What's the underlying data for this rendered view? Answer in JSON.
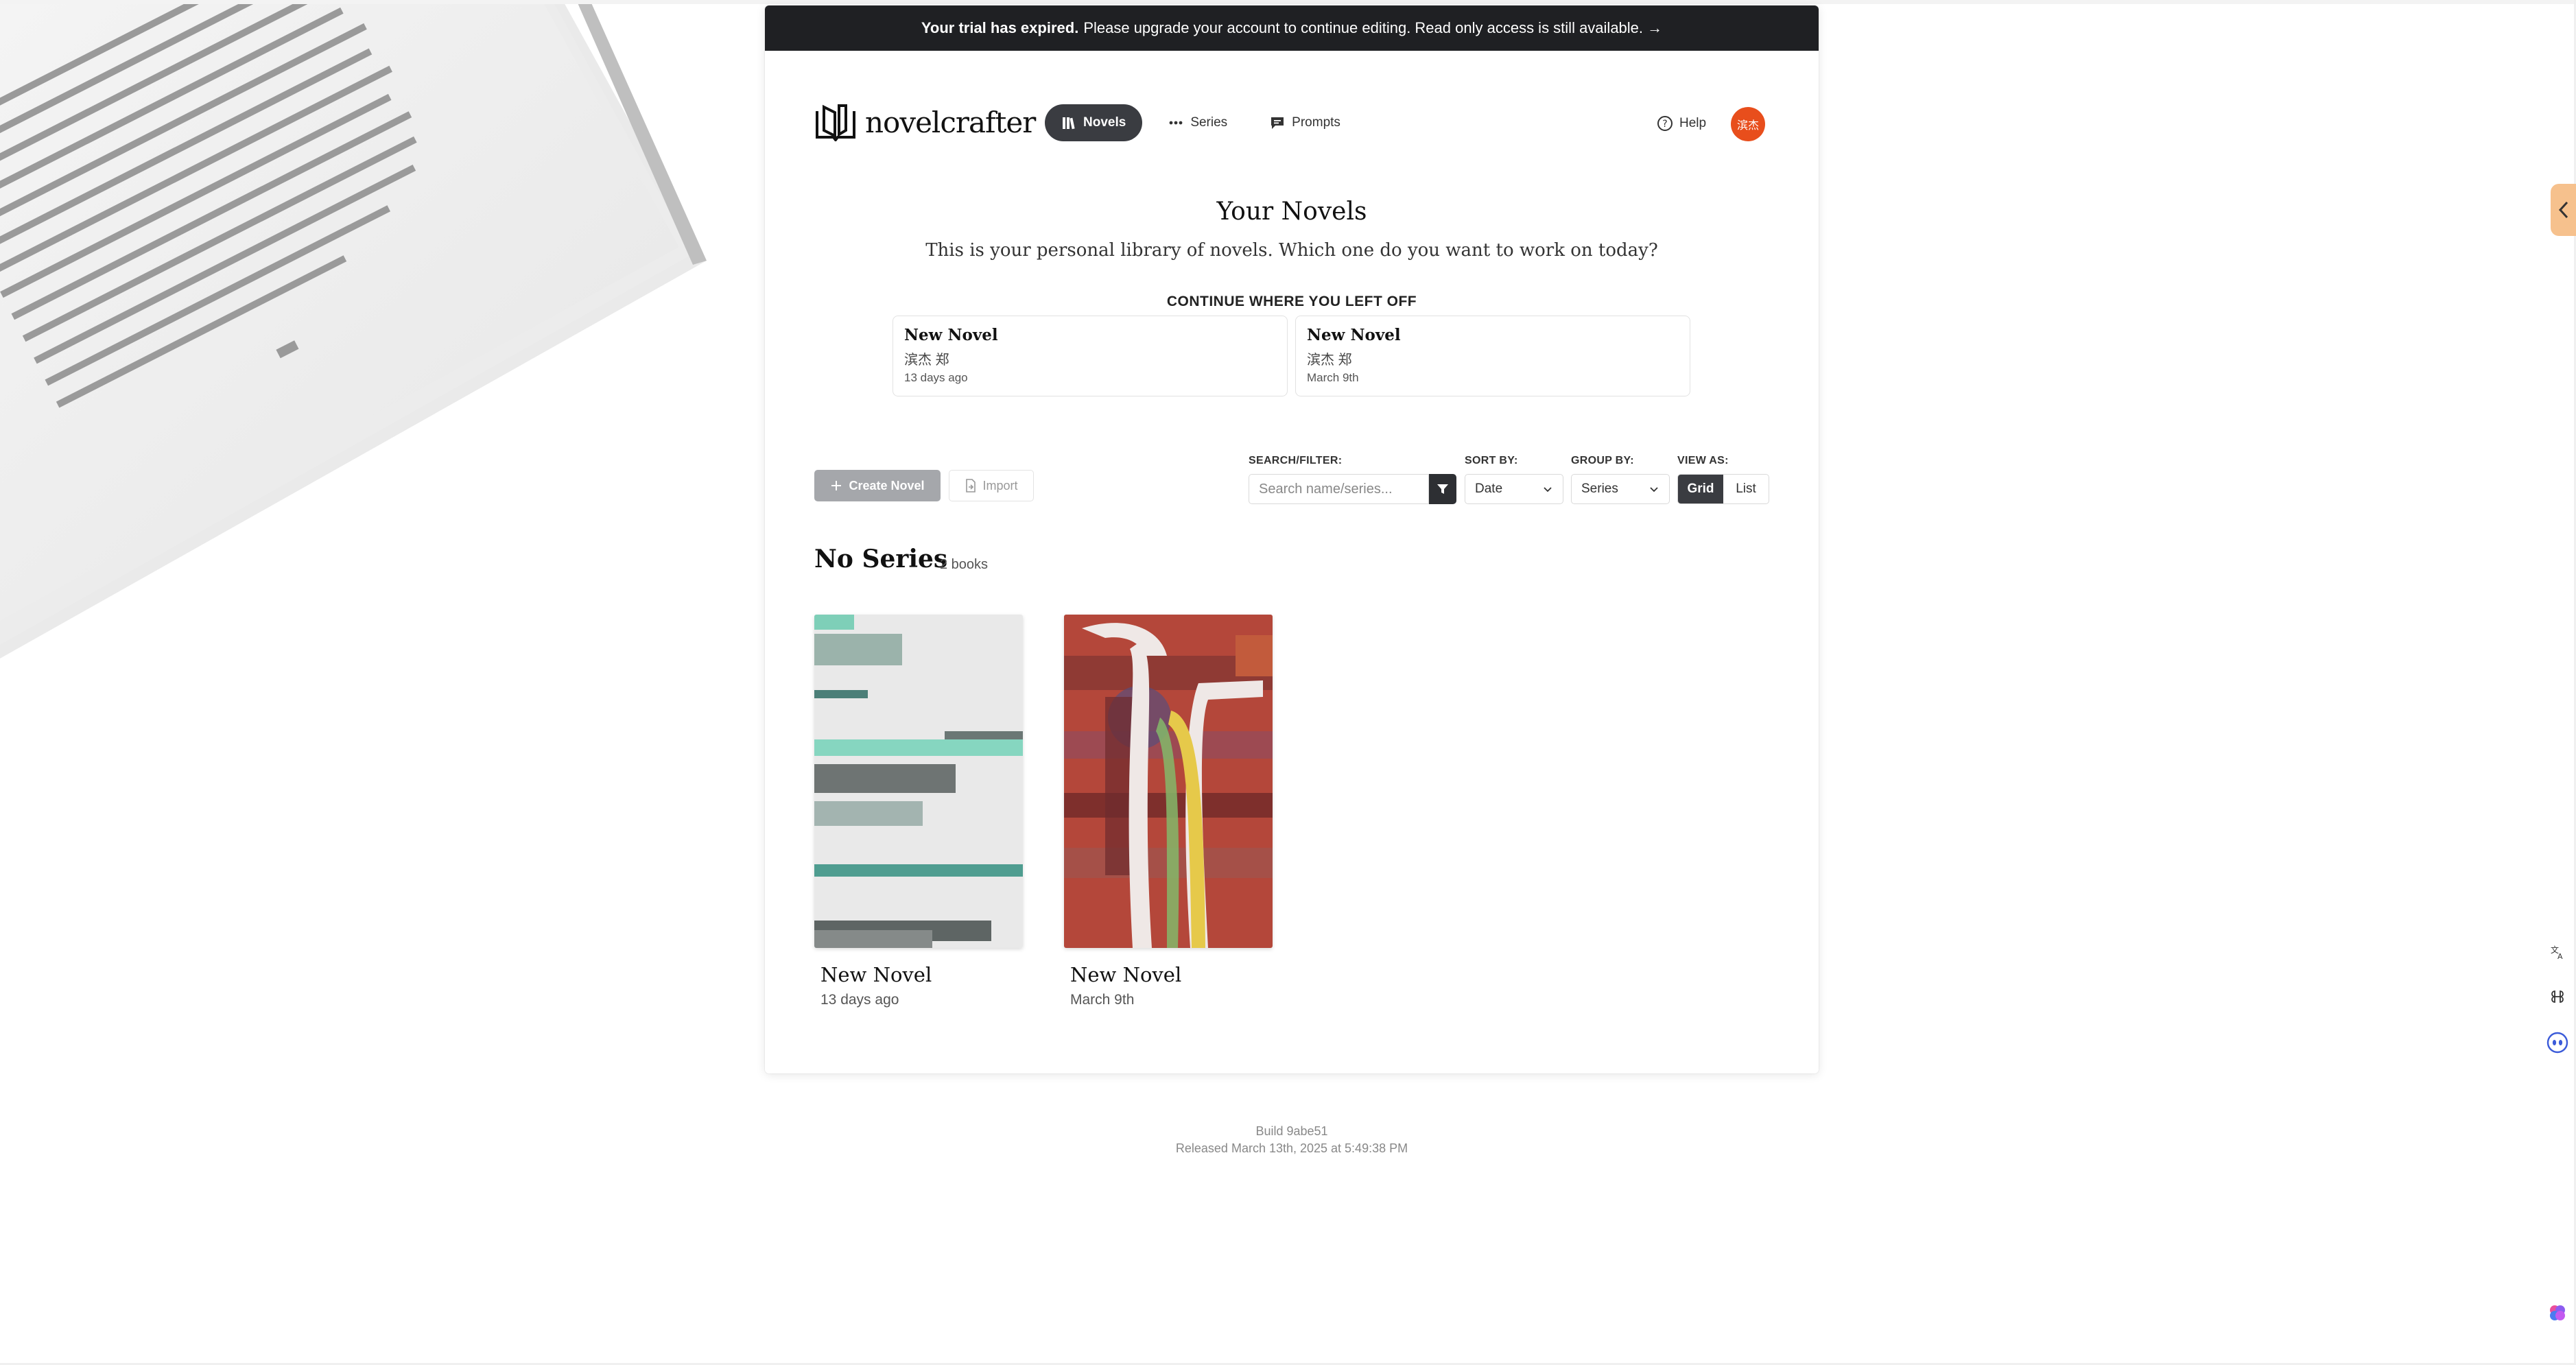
{
  "banner": {
    "bold": "Your trial has expired.",
    "text": "Please upgrade your account to continue editing. Read only access is still available. →"
  },
  "brand": {
    "name": "novelcrafter"
  },
  "nav": {
    "items": [
      {
        "label": "Novels",
        "icon": "books-icon",
        "active": true
      },
      {
        "label": "Series",
        "icon": "dots-icon",
        "active": false
      },
      {
        "label": "Prompts",
        "icon": "chat-icon",
        "active": false
      }
    ],
    "help": "Help",
    "avatar": "滨杰"
  },
  "heading": {
    "title": "Your Novels",
    "subtitle": "This is your personal library of novels. Which one do you want to work on today?"
  },
  "continue": {
    "label": "CONTINUE WHERE YOU LEFT OFF",
    "items": [
      {
        "title": "New Novel",
        "author": "滨杰 郑",
        "date": "13 days ago"
      },
      {
        "title": "New Novel",
        "author": "滨杰 郑",
        "date": "March 9th"
      }
    ]
  },
  "toolbar": {
    "create_label": "Create Novel",
    "import_label": "Import",
    "search_label": "SEARCH/FILTER:",
    "search_placeholder": "Search name/series...",
    "sort_label": "SORT BY:",
    "sort_value": "Date",
    "group_label": "GROUP BY:",
    "group_value": "Series",
    "view_label": "VIEW AS:",
    "view_grid": "Grid",
    "view_list": "List",
    "view_selected": "Grid"
  },
  "group": {
    "name": "No Series",
    "count": "2 books",
    "books": [
      {
        "title": "New Novel",
        "date": "13 days ago"
      },
      {
        "title": "New Novel",
        "date": "March 9th"
      }
    ]
  },
  "footer": {
    "build": "Build 9abe51",
    "released": "Released March 13th, 2025 at 5:49:38 PM"
  },
  "side_tools": [
    "collapse-chevron-icon",
    "translate-icon",
    "command-icon",
    "assistant-icon",
    "brain-icon"
  ],
  "colors": {
    "banner_bg": "#1f2023",
    "accent_dark": "#3a3c41",
    "avatar_bg": "#e84e1c",
    "side_tab": "#f6c18d"
  }
}
